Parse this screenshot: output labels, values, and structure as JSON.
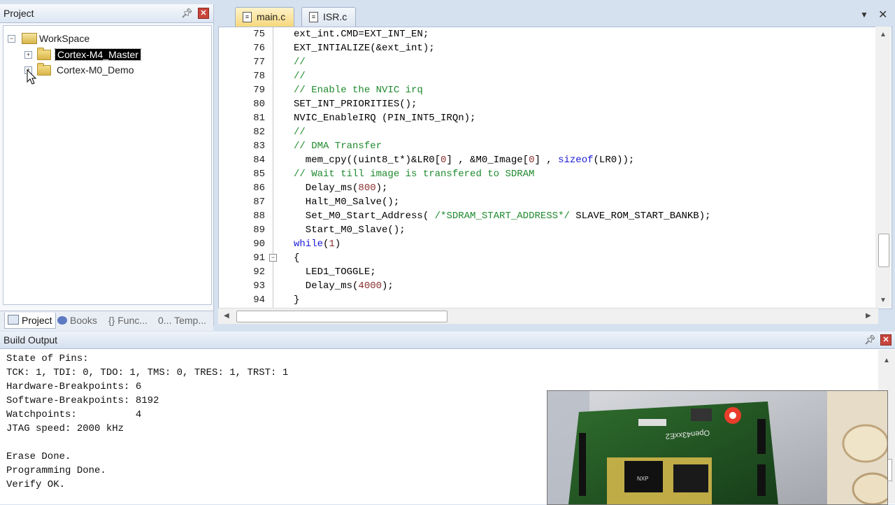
{
  "project_pane": {
    "title": "Project",
    "tree": {
      "root": "WorkSpace",
      "items": [
        {
          "label": "Cortex-M4_Master",
          "selected": true
        },
        {
          "label": "Cortex-M0_Demo",
          "selected": false
        }
      ]
    },
    "bottom_tabs": [
      "Project",
      "Books",
      "{} Func...",
      "0... Temp..."
    ]
  },
  "editor": {
    "tabs": [
      {
        "label": "main.c",
        "active": true
      },
      {
        "label": "ISR.c",
        "active": false
      }
    ],
    "lines": [
      {
        "n": "75",
        "text": "ext_int.CMD=EXT_INT_EN;"
      },
      {
        "n": "76",
        "text": "EXT_INTIALIZE(&ext_int);"
      },
      {
        "n": "77",
        "text": "//"
      },
      {
        "n": "78",
        "text": "//"
      },
      {
        "n": "79",
        "text": "// Enable the NVIC irq"
      },
      {
        "n": "80",
        "text": "SET_INT_PRIORITIES();"
      },
      {
        "n": "81",
        "text": "NVIC_EnableIRQ (PIN_INT5_IRQn);"
      },
      {
        "n": "82",
        "text": "//"
      },
      {
        "n": "83",
        "text": "// DMA Transfer"
      },
      {
        "n": "84",
        "text": "  mem_cpy((uint8_t*)&LR0[0] , &M0_Image[0] , sizeof(LR0));"
      },
      {
        "n": "85",
        "text": "// Wait till image is transfered to SDRAM"
      },
      {
        "n": "86",
        "text": "  Delay_ms(800);"
      },
      {
        "n": "87",
        "text": "  Halt_M0_Salve();"
      },
      {
        "n": "88",
        "text": "  Set_M0_Start_Address( /*SDRAM_START_ADDRESS*/ SLAVE_ROM_START_BANKB);"
      },
      {
        "n": "89",
        "text": "  Start_M0_Slave();"
      },
      {
        "n": "90",
        "text": "while(1)"
      },
      {
        "n": "91",
        "text": "{"
      },
      {
        "n": "92",
        "text": "  LED1_TOGGLE;"
      },
      {
        "n": "93",
        "text": "  Delay_ms(4000);"
      },
      {
        "n": "94",
        "text": "}"
      }
    ]
  },
  "build_output": {
    "title": "Build Output",
    "lines": [
      "State of Pins:",
      "TCK: 1, TDI: 0, TDO: 1, TMS: 0, TRES: 1, TRST: 1",
      "Hardware-Breakpoints: 6",
      "Software-Breakpoints: 8192",
      "Watchpoints:          4",
      "JTAG speed: 2000 kHz",
      "",
      "Erase Done.",
      "Programming Done.",
      "Verify OK."
    ]
  },
  "board_photo": {
    "board_marking": "Open43xxE2",
    "chip_marking": "NXP"
  },
  "colors": {
    "comment": "#1f8a2e",
    "keyword": "#1a1ad6",
    "number": "#8b2f2f",
    "active_tab": "#f7d77d"
  }
}
